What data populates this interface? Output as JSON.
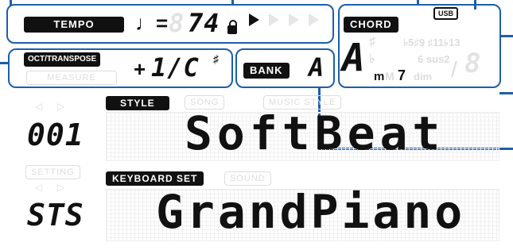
{
  "tempo": {
    "label": "TEMPO",
    "note_symbol": "♩=",
    "value": "74",
    "ghost_digit": "8"
  },
  "play_indicators": [
    "play-on",
    "play-off",
    "play-off",
    "play-off"
  ],
  "chord": {
    "label": "CHORD",
    "root": "A",
    "sharp": "♯",
    "flat": "♭",
    "minor": "m",
    "major_m": "M",
    "seventh": "7",
    "ext1": "♭5♯9 ♯11♭13",
    "ext2": "6 sus2",
    "dim": "dim",
    "slash": "/",
    "bass": "8"
  },
  "usb_label": "USB",
  "oct": {
    "label": "OCT/TRANSPOSE",
    "sub_label": "MEASURE",
    "sign": "+",
    "value": "1/C",
    "sharp": "♯"
  },
  "bank": {
    "label": "BANK",
    "value": "A"
  },
  "style": {
    "number": "001",
    "tab_active": "STYLE",
    "tab_song": "SONG",
    "tab_music_style": "MUSIC STYLE",
    "name": "SoftBeat"
  },
  "setting": {
    "label": "SETTING",
    "number": "STS",
    "tab_active": "KEYBOARD SET",
    "tab_sound": "SOUND",
    "name": "GrandPiano"
  }
}
